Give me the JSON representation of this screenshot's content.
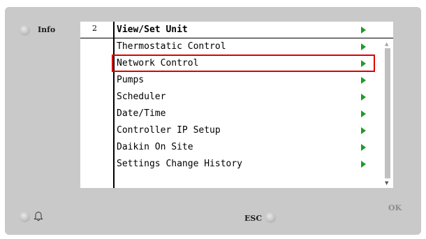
{
  "panel": {
    "info_label": "Info",
    "esc_label": "ESC",
    "ok_label": "OK",
    "bell_icon": "bell-icon"
  },
  "screen": {
    "page_index": "2",
    "title": "View/Set Unit",
    "items": [
      {
        "label": "Thermostatic Control"
      },
      {
        "label": "Network Control",
        "highlighted": true
      },
      {
        "label": "Pumps"
      },
      {
        "label": "Scheduler"
      },
      {
        "label": "Date/Time"
      },
      {
        "label": "Controller IP Setup"
      },
      {
        "label": "Daikin On Site"
      },
      {
        "label": "Settings Change History"
      }
    ],
    "arrow_icon": "green-arrow-right-icon",
    "arrow_color": "#1f9a2c",
    "highlight_color": "#e00000"
  }
}
